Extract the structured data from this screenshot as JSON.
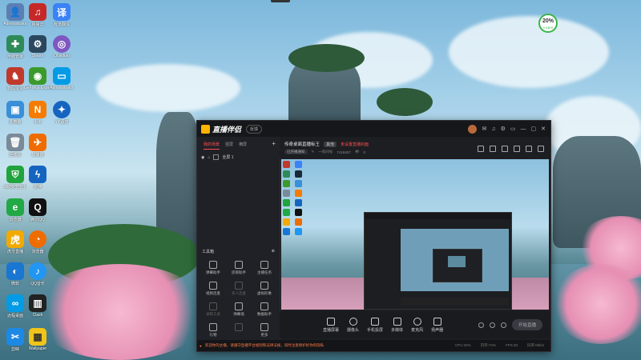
{
  "desktop": {
    "icons": [
      {
        "label": "Administrator",
        "icon": "user-folder-icon",
        "color": "#5b7fb5"
      },
      {
        "label": "电脑管家",
        "icon": "shield-icon",
        "color": "#2e8b57"
      },
      {
        "label": "数码宝贝",
        "icon": "game-icon",
        "color": "#c0392b"
      },
      {
        "label": "Steam",
        "icon": "steam-icon",
        "color": "#1b2838"
      },
      {
        "label": "GeForce Experience",
        "icon": "nvidia-icon",
        "color": "#3c9a2c"
      },
      {
        "label": "此电脑",
        "icon": "computer-icon",
        "color": "#3a8fd8"
      },
      {
        "label": "回收站",
        "icon": "recycle-bin-icon",
        "color": "#7a8a99"
      },
      {
        "label": "360安全卫士",
        "icon": "security-guard-icon",
        "color": "#21a33d"
      },
      {
        "label": "腾讯QQ",
        "icon": "qq-icon",
        "color": "#111111"
      },
      {
        "label": "虎牙直播",
        "icon": "huya-icon",
        "color": "#f2a900"
      },
      {
        "label": "Wallpaper",
        "icon": "wallpaper-icon",
        "color": "#e8e8e8"
      },
      {
        "label": "剪映",
        "icon": "video-edit-icon",
        "color": "#1e88e5"
      }
    ],
    "col2": [
      {
        "label": "网易云",
        "icon": "music-icon",
        "color": "#c62828"
      },
      {
        "label": "Steam",
        "icon": "steam-icon",
        "color": "#2a475e"
      },
      {
        "label": "有道翻译",
        "icon": "translate-icon",
        "color": "#3b82f6"
      },
      {
        "label": "小米",
        "icon": "app-icon",
        "color": "#f57c00"
      },
      {
        "label": "加速器",
        "icon": "accelerator-icon",
        "color": "#1565c0"
      },
      {
        "label": "雷神",
        "icon": "lightning-icon",
        "color": "#ef6c00"
      },
      {
        "label": "浏览器",
        "icon": "browser-icon",
        "color": "#0d47a1"
      },
      {
        "label": "QQ音乐",
        "icon": "qq-music-icon",
        "color": "#2196f3"
      },
      {
        "label": "Clash",
        "icon": "chart-app-icon",
        "color": "#222222"
      }
    ],
    "col3": [
      {
        "label": "微软",
        "icon": "edge-icon",
        "color": "#1976d2"
      },
      {
        "label": "Obsidian",
        "icon": "obsidian-icon",
        "color": "#7e57c2"
      },
      {
        "label": "远程桌面",
        "icon": "remote-desktop-icon",
        "color": "#039be5"
      },
      {
        "label": "YY语音",
        "icon": "yy-icon",
        "color": "#1565c0"
      }
    ],
    "net_badge": {
      "percent": "20%",
      "speed": "0 KB/S"
    }
  },
  "app": {
    "brand": "直播伴侣",
    "feedback_label": "反馈",
    "sidebar": {
      "tabs": [
        "我的场景",
        "竖屏",
        "横屏"
      ],
      "active_tab": 0,
      "scene_label": "全屏 1",
      "toolbox_title": "工具箱",
      "tools": [
        {
          "label": "弹幕助手",
          "icon": "danmaku-icon",
          "dim": false
        },
        {
          "label": "房管助手",
          "icon": "user-manage-icon",
          "dim": false
        },
        {
          "label": "主播任务",
          "icon": "task-icon",
          "dim": false
        },
        {
          "label": "视频连麦",
          "icon": "video-call-icon",
          "dim": false
        },
        {
          "label": "多人连麦",
          "icon": "multi-call-icon",
          "dim": true
        },
        {
          "label": "虚拟形象",
          "icon": "avatar-icon",
          "dim": false
        },
        {
          "label": "录制工具",
          "icon": "record-icon",
          "dim": true
        },
        {
          "label": "弹幕墙",
          "icon": "danmaku-wall-icon",
          "dim": false
        },
        {
          "label": "数据助手",
          "icon": "data-icon",
          "dim": false
        },
        {
          "label": "礼物",
          "icon": "gift-icon",
          "dim": false
        },
        {
          "label": "",
          "icon": "blank-icon",
          "dim": true
        },
        {
          "label": "更多",
          "icon": "more-icon",
          "dim": false
        }
      ]
    },
    "stream": {
      "title": "传奇桌面直播标王",
      "category_tag": "其他",
      "warning": "未设置直播封面",
      "sub_tag": "已开播通知",
      "room_label": "一房间号",
      "room_id": "7418457",
      "viewers": "0"
    },
    "controls": [
      {
        "label": "直播屏幕",
        "icon": "screen-share-icon"
      },
      {
        "label": "摄像头",
        "icon": "camera-icon"
      },
      {
        "label": "手机投屏",
        "icon": "phone-cast-icon"
      },
      {
        "label": "多媒体",
        "icon": "media-icon"
      },
      {
        "label": "麦克风",
        "icon": "microphone-icon"
      },
      {
        "label": "扬声器",
        "icon": "speaker-icon"
      }
    ],
    "start_label": "开始直播",
    "notice": "欢迎你的主播，请遵守直播平台规则和法律法规，同时注意保护好你的隐私",
    "stats": [
      "CPU:33%",
      "内存:74%",
      "FPS:30",
      "码率:0kb/s"
    ]
  }
}
